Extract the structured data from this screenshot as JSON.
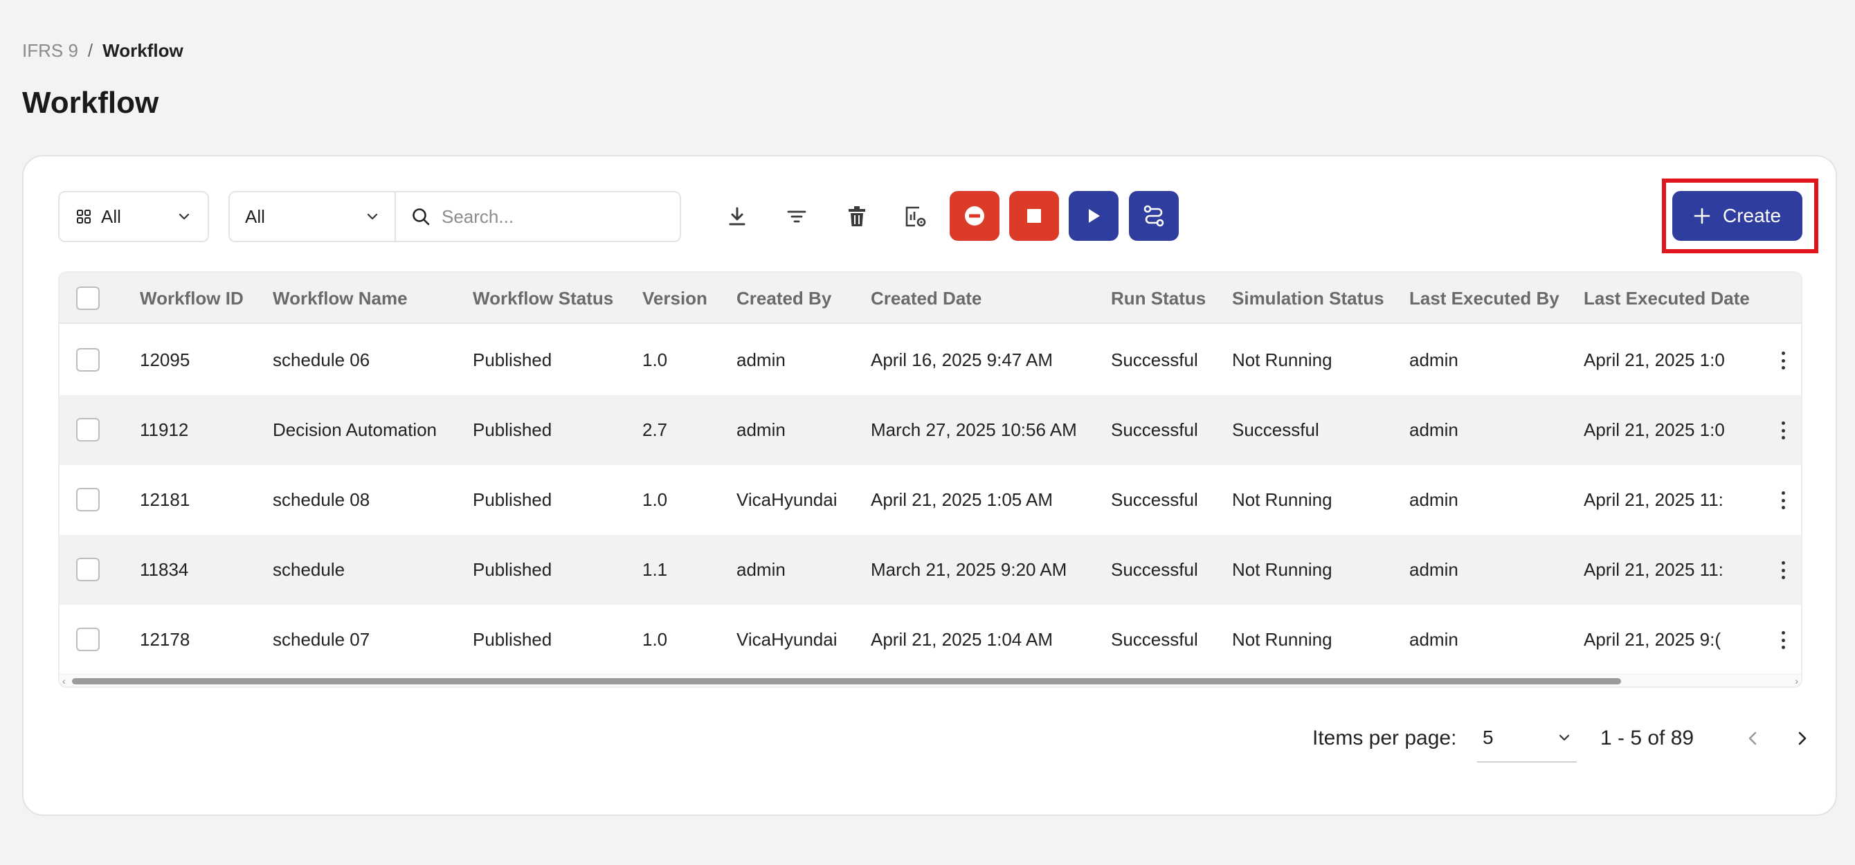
{
  "breadcrumb": {
    "parent": "IFRS 9",
    "separator": "/",
    "current": "Workflow"
  },
  "page_title": "Workflow",
  "toolbar": {
    "view_select": "All",
    "filter_select": "All",
    "search_placeholder": "Search...",
    "create_label": "Create",
    "colors": {
      "red": "#dc3b2a",
      "blue": "#2f3e9e",
      "highlight": "#e0151b"
    }
  },
  "table": {
    "columns": [
      "Workflow ID",
      "Workflow Name",
      "Workflow Status",
      "Version",
      "Created By",
      "Created Date",
      "Run Status",
      "Simulation Status",
      "Last Executed By",
      "Last Executed Date"
    ],
    "rows": [
      [
        "12095",
        "schedule 06",
        "Published",
        "1.0",
        "admin",
        "April 16, 2025 9:47 AM",
        "Successful",
        "Not Running",
        "admin",
        "April 21, 2025 1:0"
      ],
      [
        "11912",
        "Decision Automation",
        "Published",
        "2.7",
        "admin",
        "March 27, 2025 10:56 AM",
        "Successful",
        "Successful",
        "admin",
        "April 21, 2025 1:0"
      ],
      [
        "12181",
        "schedule 08",
        "Published",
        "1.0",
        "VicaHyundai",
        "April 21, 2025 1:05 AM",
        "Successful",
        "Not Running",
        "admin",
        "April 21, 2025 11:"
      ],
      [
        "11834",
        "schedule",
        "Published",
        "1.1",
        "admin",
        "March 21, 2025 9:20 AM",
        "Successful",
        "Not Running",
        "admin",
        "April 21, 2025 11:"
      ],
      [
        "12178",
        "schedule 07",
        "Published",
        "1.0",
        "VicaHyundai",
        "April 21, 2025 1:04 AM",
        "Successful",
        "Not Running",
        "admin",
        "April 21, 2025 9:("
      ]
    ]
  },
  "pagination": {
    "items_per_page_label": "Items per page:",
    "items_per_page": "5",
    "range": "1 - 5 of 89"
  }
}
